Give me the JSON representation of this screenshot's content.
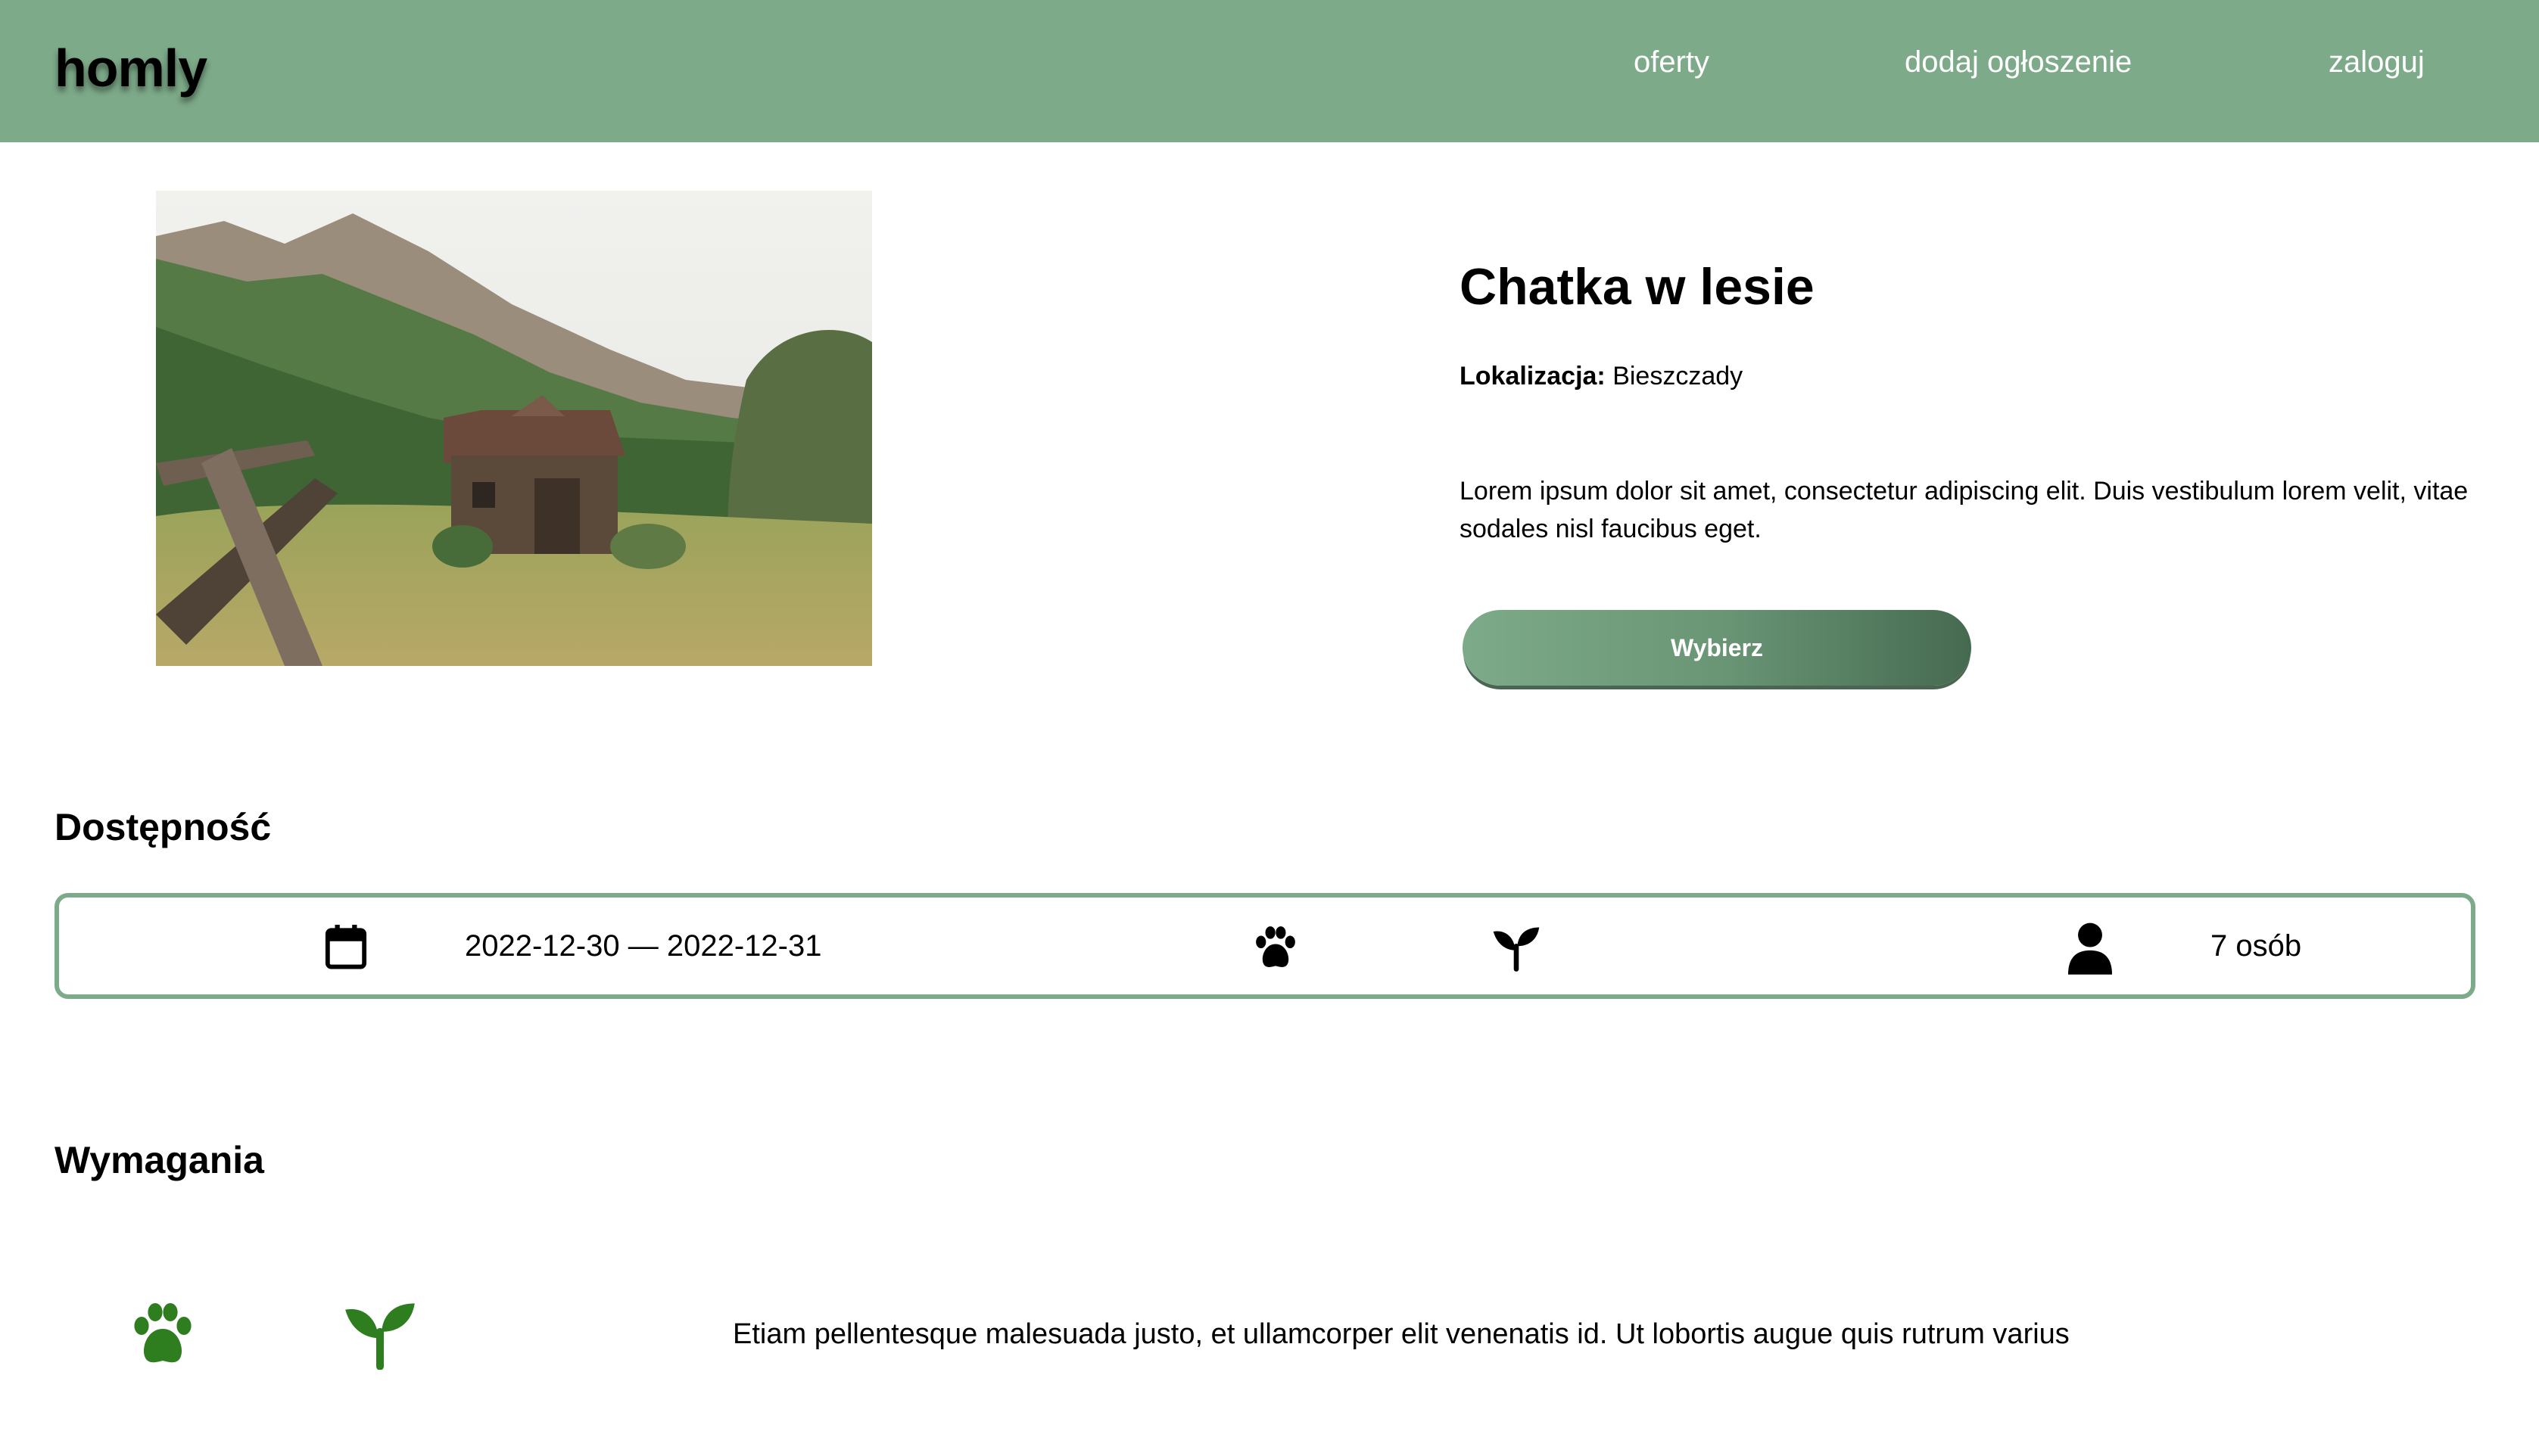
{
  "header": {
    "logo": "homly",
    "nav": [
      {
        "label": "oferty"
      },
      {
        "label": "dodaj ogłoszenie"
      },
      {
        "label": "zaloguj"
      }
    ],
    "background": "#7daa89"
  },
  "listing": {
    "title": "Chatka w lesie",
    "location_label": "Lokalizacja:",
    "location_value": "Bieszczady",
    "description": "Lorem ipsum dolor sit amet, consectetur adipiscing elit. Duis vestibulum lorem velit, vitae sodales nisl faucibus eget.",
    "button_label": "Wybierz",
    "image_alt": "cabin-in-mountain-meadow-photo"
  },
  "availability": {
    "heading": "Dostępność",
    "dates": "2022-12-30 — 2022-12-31",
    "guests": "7 osób",
    "icons": [
      "calendar-icon",
      "paw-icon",
      "sprout-icon",
      "person-icon"
    ],
    "border_color": "#7daa89"
  },
  "requirements": {
    "heading": "Wymagania",
    "icons": [
      "paw-icon",
      "sprout-icon"
    ],
    "icon_color": "#2e7d1f",
    "text": "Etiam pellentesque malesuada justo, et ullamcorper elit venenatis id. Ut lobortis augue quis rutrum varius"
  }
}
